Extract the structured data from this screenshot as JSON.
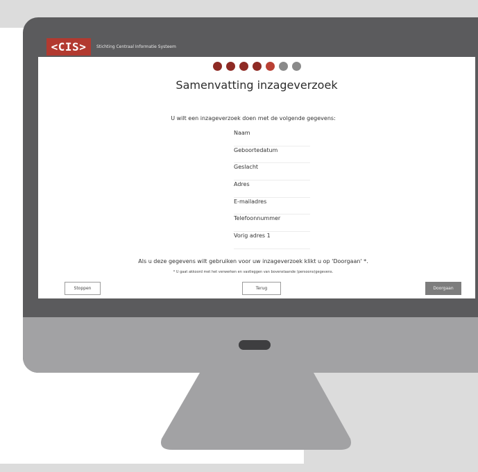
{
  "header": {
    "logo_text": "<CIS>",
    "org_name": "Stichting Centraal Informatie Systeem"
  },
  "progress": {
    "total_steps": 7,
    "completed_steps": 4,
    "current_step": 5
  },
  "page": {
    "title": "Samenvatting inzageverzoek",
    "intro": "U wilt een inzageverzoek doen met de volgende gegevens:",
    "fields": [
      "Naam",
      "Geboortedatum",
      "Geslacht",
      "Adres",
      "E-mailadres",
      "Telefoonnummer",
      "Vorig adres 1"
    ],
    "cta": "Als u deze gegevens wilt gebruiken voor uw inzageverzoek klikt u op 'Doorgaan' *.",
    "consent": "* U gaat akkoord met het verwerken en vastleggen van bovenstaande (persoons)gegevens."
  },
  "buttons": {
    "stop": "Stoppen",
    "back": "Terug",
    "continue": "Doorgaan"
  },
  "colors": {
    "brand": "#b23a30",
    "step_done": "#8e2a24",
    "step_todo": "#8a8a8a",
    "primary_button": "#7d7d7d",
    "monitor_frame": "#5b5b5d"
  }
}
